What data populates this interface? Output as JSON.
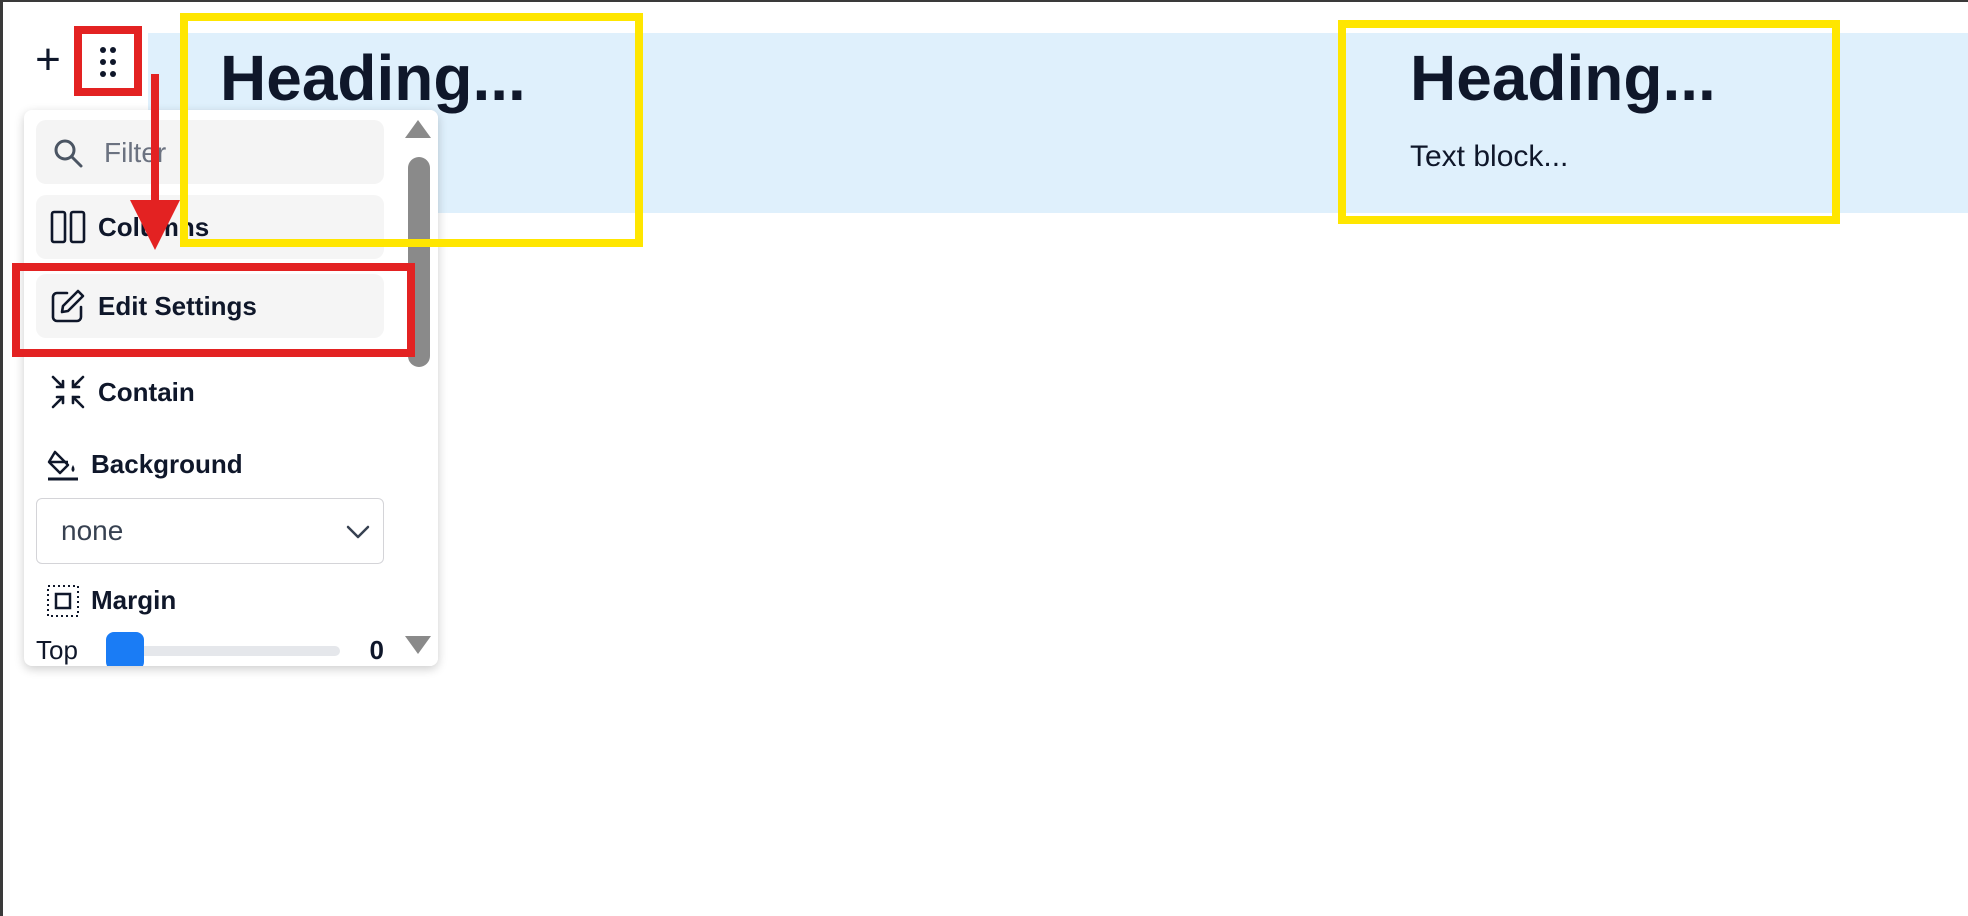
{
  "canvas": {
    "columns": [
      {
        "heading": "Heading..."
      },
      {
        "heading": "Heading...",
        "text": "Text block..."
      }
    ]
  },
  "toolbar": {
    "add_label": "+",
    "drag_icon": "drag-dots-icon"
  },
  "menu": {
    "filter_placeholder": "Filter",
    "filter_value": "",
    "items": [
      {
        "label": "Columns",
        "icon": "columns-icon"
      },
      {
        "label": "Edit Settings",
        "icon": "edit-icon"
      },
      {
        "label": "Contain",
        "icon": "contain-icon"
      }
    ],
    "background": {
      "label": "Background",
      "icon": "paint-bucket-icon",
      "selected": "none"
    },
    "margin": {
      "label": "Margin",
      "icon": "margin-icon",
      "top_label": "Top",
      "top_value": "0",
      "top_level": 0
    }
  },
  "colors": {
    "accent": "#1a7cf5",
    "band": "#dff0fc",
    "annotation_yellow": "#ffe600",
    "annotation_red": "#e32222"
  }
}
